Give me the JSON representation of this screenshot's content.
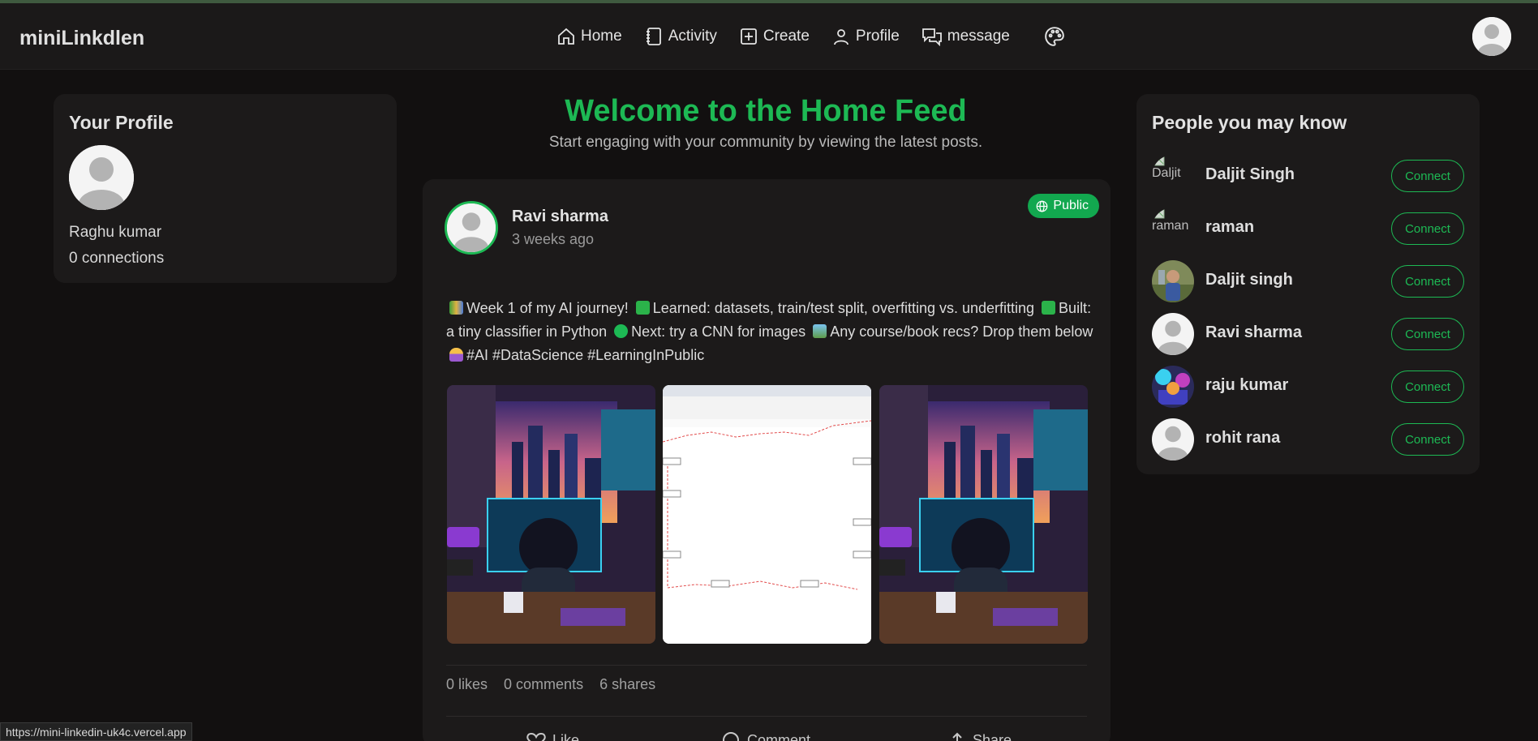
{
  "navbar": {
    "brand": "miniLinkdlen",
    "items": [
      {
        "label": "Home",
        "icon": "home-icon"
      },
      {
        "label": "Activity",
        "icon": "notebook-icon"
      },
      {
        "label": "Create",
        "icon": "plus-square-icon"
      },
      {
        "label": "Profile",
        "icon": "user-icon"
      },
      {
        "label": "message",
        "icon": "chat-icon"
      }
    ],
    "theme_icon": "palette-icon",
    "avatar_icon": "user-avatar-icon"
  },
  "profile": {
    "title": "Your Profile",
    "name": "Raghu kumar",
    "connections": "0 connections"
  },
  "feed": {
    "title": "Welcome to the Home Feed",
    "subtitle": "Start engaging with your community by viewing the latest posts."
  },
  "post": {
    "author": "Ravi sharma",
    "time": "3 weeks ago",
    "visibility": "Public",
    "text_parts": [
      "Week 1 of my AI journey!",
      "Learned: datasets, train/test split, overfitting vs. underfitting",
      "Built:",
      "a tiny classifier in Python",
      "Next: try a CNN for images",
      "Any course/book recs? Drop them below",
      "#AI #DataScience #LearningInPublic"
    ],
    "images": [
      "ai-workspace-image",
      "screenshot-diagram-image",
      "ai-workspace-image"
    ],
    "stats": {
      "likes": "0 likes",
      "comments": "0 comments",
      "shares": "6 shares"
    },
    "actions": {
      "like": "Like",
      "comment": "Comment",
      "share": "Share"
    }
  },
  "people": {
    "title": "People you may know",
    "connect_label": "Connect",
    "list": [
      {
        "name": "Daljit Singh",
        "avatar_alt": "Daljit",
        "avatar": "broken-image"
      },
      {
        "name": "raman",
        "avatar_alt": "raman",
        "avatar": "broken-image"
      },
      {
        "name": "Daljit singh",
        "avatar": "photo"
      },
      {
        "name": "Ravi sharma",
        "avatar": "default-user"
      },
      {
        "name": "raju kumar",
        "avatar": "photo-colorful"
      },
      {
        "name": "rohit rana",
        "avatar": "default-user"
      }
    ]
  },
  "status_bar": {
    "url": "https://mini-linkedin-uk4c.vercel.app"
  },
  "colors": {
    "accent": "#1db954",
    "background": "#121010",
    "card": "#1c1a1a"
  }
}
